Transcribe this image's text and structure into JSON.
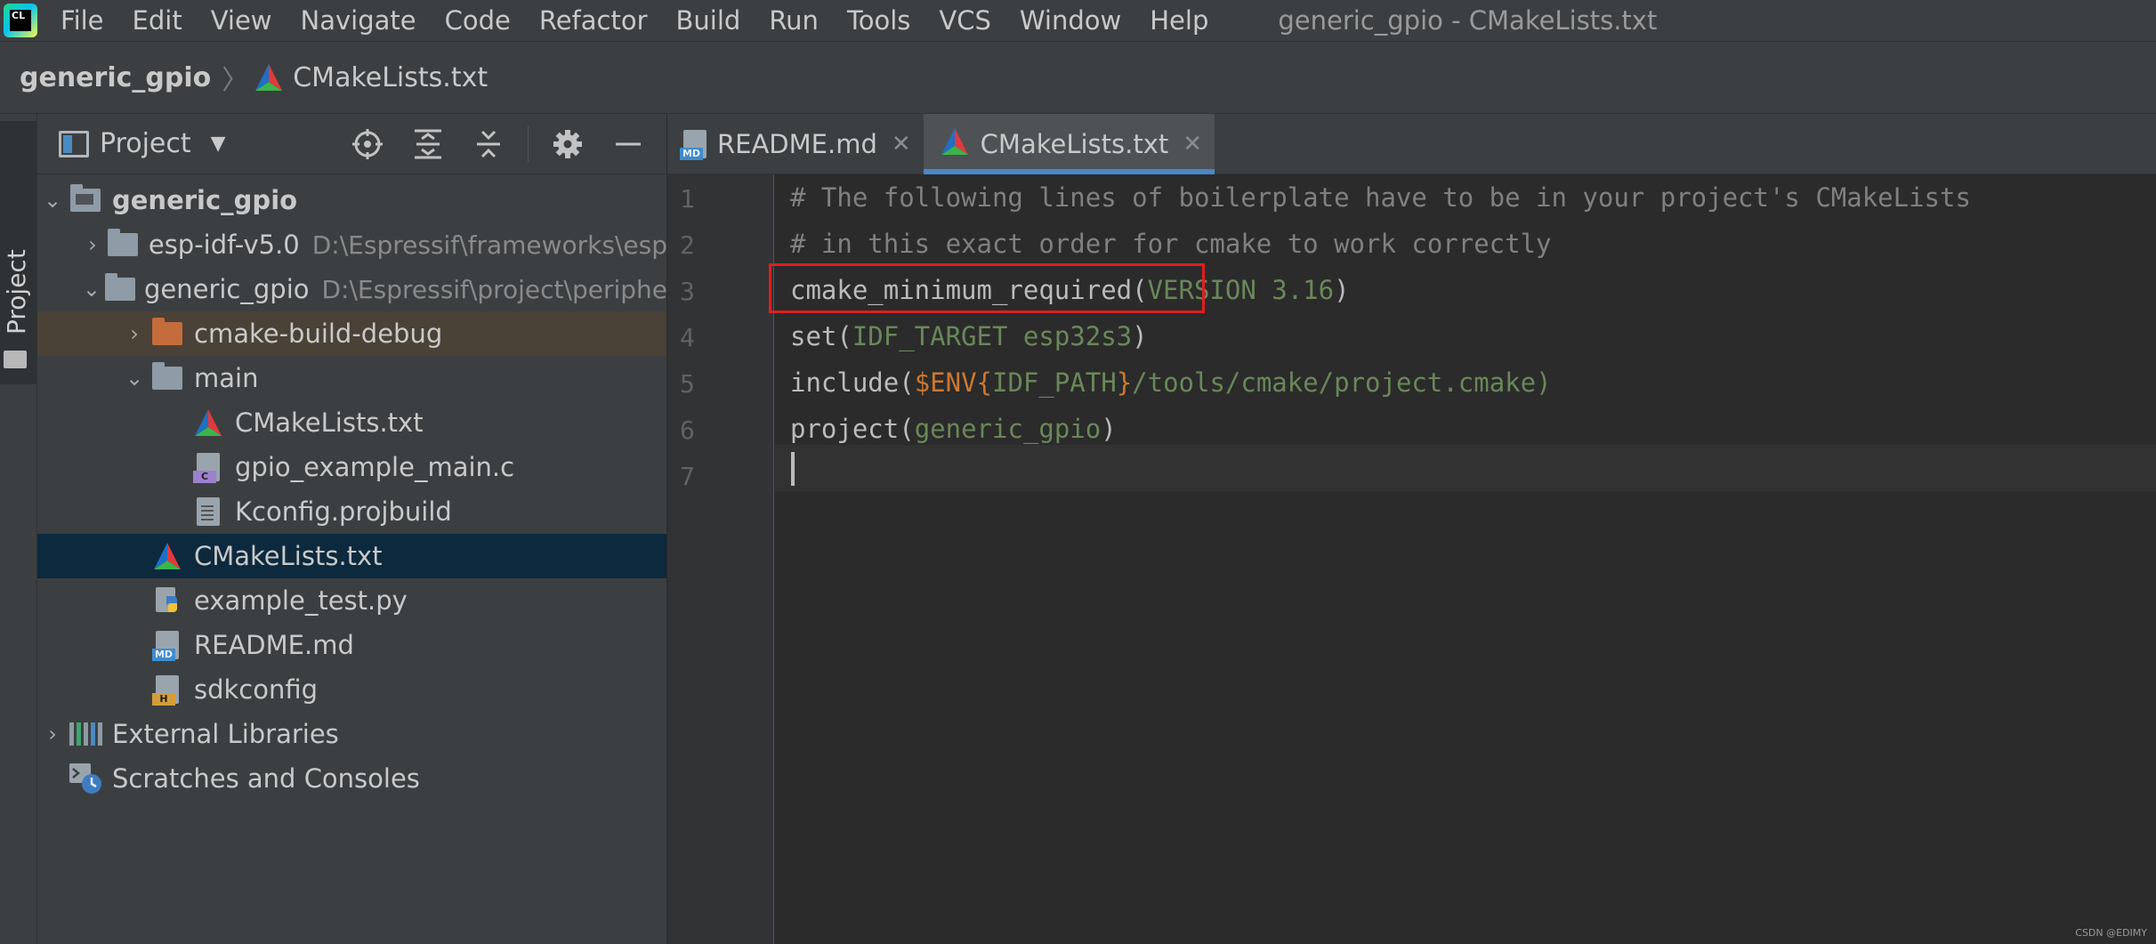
{
  "app": {
    "logo_text": "CL",
    "window_title": "generic_gpio - CMakeLists.txt"
  },
  "menu": [
    "File",
    "Edit",
    "View",
    "Navigate",
    "Code",
    "Refactor",
    "Build",
    "Run",
    "Tools",
    "VCS",
    "Window",
    "Help"
  ],
  "breadcrumb": {
    "project": "generic_gpio",
    "file": "CMakeLists.txt"
  },
  "toolstrip": {
    "label": "Project"
  },
  "project_panel": {
    "title": "Project",
    "tree": [
      {
        "label": "generic_gpio",
        "bold": true
      },
      {
        "label": "esp-idf-v5.0",
        "path": "D:\\Espressif\\frameworks\\esp"
      },
      {
        "label": "generic_gpio",
        "path": "D:\\Espressif\\project\\periphe"
      },
      {
        "label": "cmake-build-debug"
      },
      {
        "label": "main"
      },
      {
        "label": "CMakeLists.txt"
      },
      {
        "label": "gpio_example_main.c"
      },
      {
        "label": "Kconfig.projbuild"
      },
      {
        "label": "CMakeLists.txt"
      },
      {
        "label": "example_test.py"
      },
      {
        "label": "README.md"
      },
      {
        "label": "sdkconfig"
      },
      {
        "label": "External Libraries"
      },
      {
        "label": "Scratches and Consoles"
      }
    ]
  },
  "editor": {
    "tabs": [
      {
        "label": "README.md",
        "close": "✕",
        "icon": "markdown-file-icon"
      },
      {
        "label": "CMakeLists.txt",
        "close": "✕",
        "icon": "cmake-file-icon"
      }
    ],
    "line_numbers": [
      "1",
      "2",
      "3",
      "4",
      "5",
      "6",
      "7"
    ],
    "lines": [
      {
        "comment": "# The following lines of boilerplate have to be in your project's CMakeLists"
      },
      {
        "comment": "# in this exact order for cmake to work correctly"
      },
      {
        "fn": "cmake_minimum_required(",
        "arg": "VERSION 3.16",
        "end": ")"
      },
      {
        "fn": "set(",
        "arg": "IDF_TARGET esp32s3",
        "end": ")"
      },
      {
        "fn": "include(",
        "env": "$ENV{",
        "arg": "IDF_PATH",
        "env_end": "}",
        "rest": "/tools/cmake/project.cmake)"
      },
      {
        "fn": "project(",
        "arg": "generic_gpio",
        "end": ")"
      },
      {
        "fn": ""
      }
    ]
  },
  "watermark": "CSDN @EDIMY",
  "colors": {
    "accent": "#4a88c7",
    "highlight_box": "#e01f1f",
    "selection": "#0d293e",
    "string_arg": "#6a8759",
    "keyword_env": "#cc7832"
  }
}
